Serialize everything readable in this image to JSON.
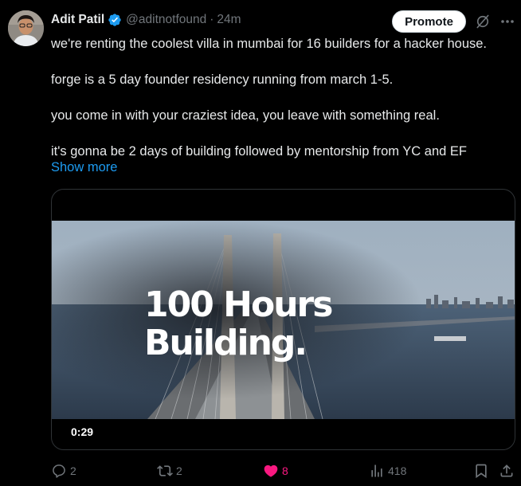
{
  "author": {
    "name": "Adit Patil",
    "handle": "@aditnotfound",
    "separator": "·",
    "time": "24m"
  },
  "header": {
    "promote_label": "Promote",
    "icons": [
      "verified-badge-icon",
      "grok-icon",
      "more-icon"
    ]
  },
  "tweet": {
    "paragraphs": [
      "we're renting the coolest villa in mumbai for 16 builders for a hacker house.",
      "forge is a 5 day founder residency running from march 1-5.",
      "you come in with your craziest idea, you leave with something real.",
      "it's gonna be 2  days of building followed by mentorship from YC and EF"
    ],
    "show_more": "Show more"
  },
  "media": {
    "title_line1": "100 Hours",
    "title_line2": "Building.",
    "duration": "0:29"
  },
  "actions": {
    "replies": "2",
    "reposts": "2",
    "likes": "8",
    "views": "418"
  },
  "colors": {
    "background": "#000000",
    "text": "#e7e9ea",
    "muted": "#71767b",
    "link": "#1d9bf0",
    "like": "#f91880",
    "verified": "#1d9bf0"
  }
}
